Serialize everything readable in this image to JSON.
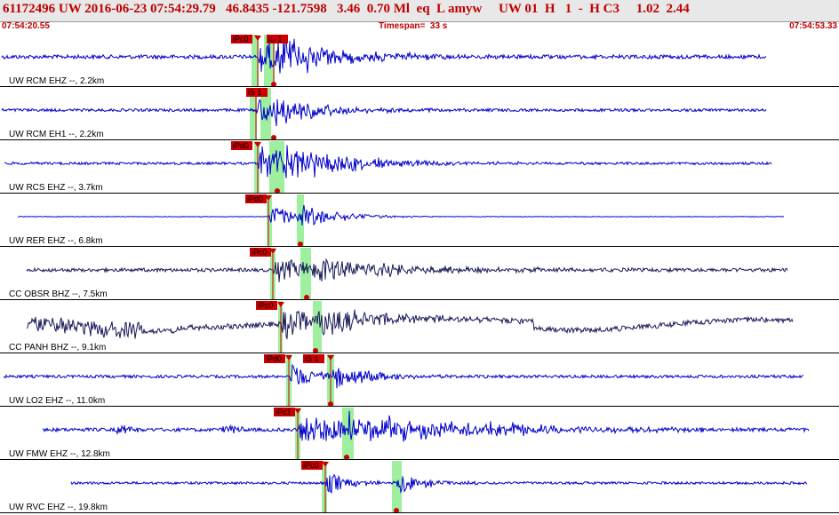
{
  "header": {
    "event_summary": "61172496 UW 2016-06-23 07:54:29.79   46.8435 -121.7598   3.46  0.70 Ml  eq  L amyw     UW 01  H   1  -  H C3     1.02  2.44",
    "start_time": "07:54:20.55",
    "timespan": "Timespan=  33 s",
    "end_time": "07:54:53.33"
  },
  "colors": {
    "header_text": "#c00000",
    "trace_blue": "#0000cc",
    "trace_dark": "#1a1a5a",
    "pick_red": "#cc0000",
    "window_green": "#9ef09e"
  },
  "traces": [
    {
      "label": "UW RCM EHZ --, 2.2km",
      "picks": [
        {
          "label": "iPc0"
        },
        {
          "label": "iS 1"
        }
      ]
    },
    {
      "label": "UW RCM EH1 --, 2.2km",
      "picks": [
        {
          "label": "iS 1"
        }
      ]
    },
    {
      "label": "UW RCS EHZ --, 3.7km",
      "picks": [
        {
          "label": "iPd0"
        }
      ]
    },
    {
      "label": "UW RER EHZ --, 6.8km",
      "picks": [
        {
          "label": "iPd0"
        }
      ]
    },
    {
      "label": "CC OBSR BHZ --, 7.5km",
      "picks": [
        {
          "label": "iPc0"
        }
      ]
    },
    {
      "label": "CC PANH BHZ --, 9.1km",
      "picks": [
        {
          "label": "iPc0"
        }
      ]
    },
    {
      "label": "UW LO2 EHZ --, 11.0km",
      "picks": [
        {
          "label": "iPd0"
        },
        {
          "label": "iS 1"
        }
      ]
    },
    {
      "label": "UW FMW EHZ --, 12.8km",
      "picks": [
        {
          "label": "iPc1"
        }
      ]
    },
    {
      "label": "UW RVC EHZ --, 19.8km",
      "picks": [
        {
          "label": "iPc0"
        }
      ]
    }
  ]
}
